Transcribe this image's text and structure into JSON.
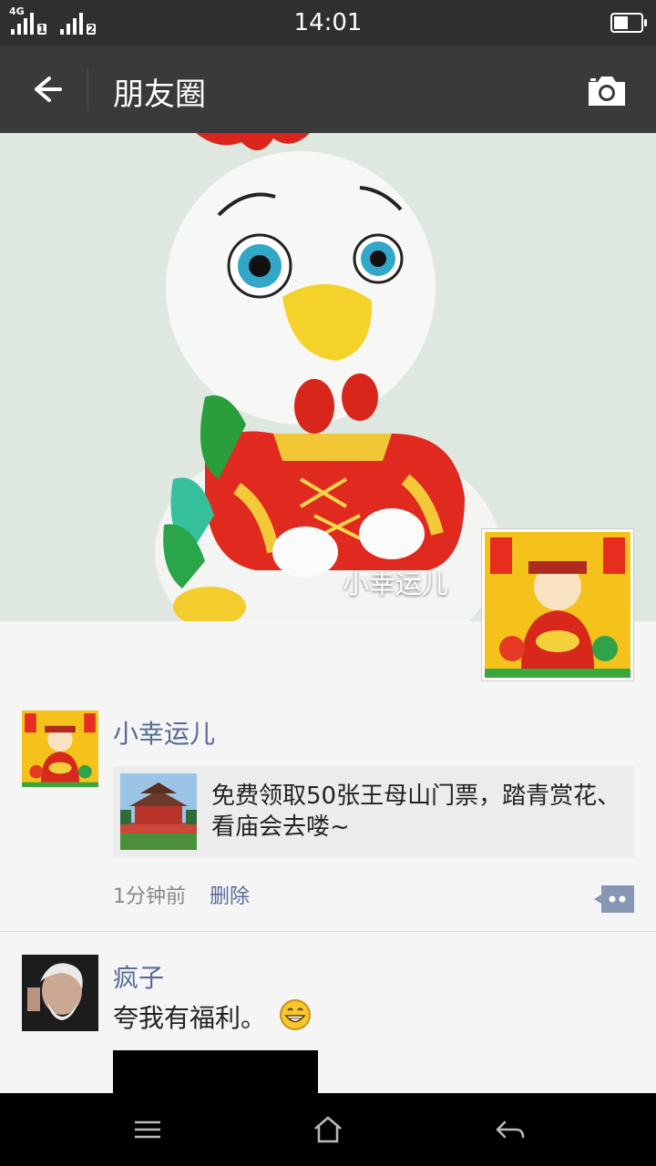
{
  "status_bar": {
    "network": "4G",
    "sim1": "1",
    "sim2": "2",
    "time": "14:01",
    "battery_level": 0.55
  },
  "header": {
    "back_icon": "arrow-left-icon",
    "title": "朋友圈",
    "camera_icon": "camera-icon"
  },
  "cover": {
    "name": "小幸运儿"
  },
  "posts": [
    {
      "name": "小幸运儿",
      "share_text": "免费领取50张王母山门票，踏青赏花、看庙会去喽~",
      "time": "1分钟前",
      "delete_label": "删除",
      "comment_icon": "comment-dots-icon"
    },
    {
      "name": "疯子",
      "text": "夸我有福利。",
      "emoji_icon": "grin-emoji-icon"
    }
  ],
  "nav_bar": {
    "menu_icon": "menu-icon",
    "home_icon": "home-icon",
    "back_icon": "back-icon"
  },
  "colors": {
    "status_bar": "#2f2f31",
    "header": "#3a3a3d",
    "link": "#576b95",
    "background": "#f5f5f5"
  }
}
